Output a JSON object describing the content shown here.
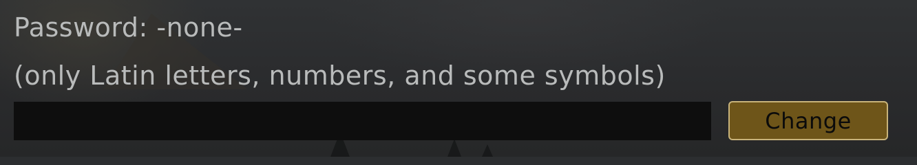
{
  "password": {
    "title": "Password: -none-",
    "hint": "(only Latin letters, numbers, and some symbols)",
    "input_value": "",
    "change_label": "Change"
  },
  "colors": {
    "text": "#b9bbbb",
    "input_bg": "#0e0e0e",
    "button_bg": "#6e5519",
    "button_border": "#c8b37a",
    "button_text": "#0b0b0b"
  }
}
